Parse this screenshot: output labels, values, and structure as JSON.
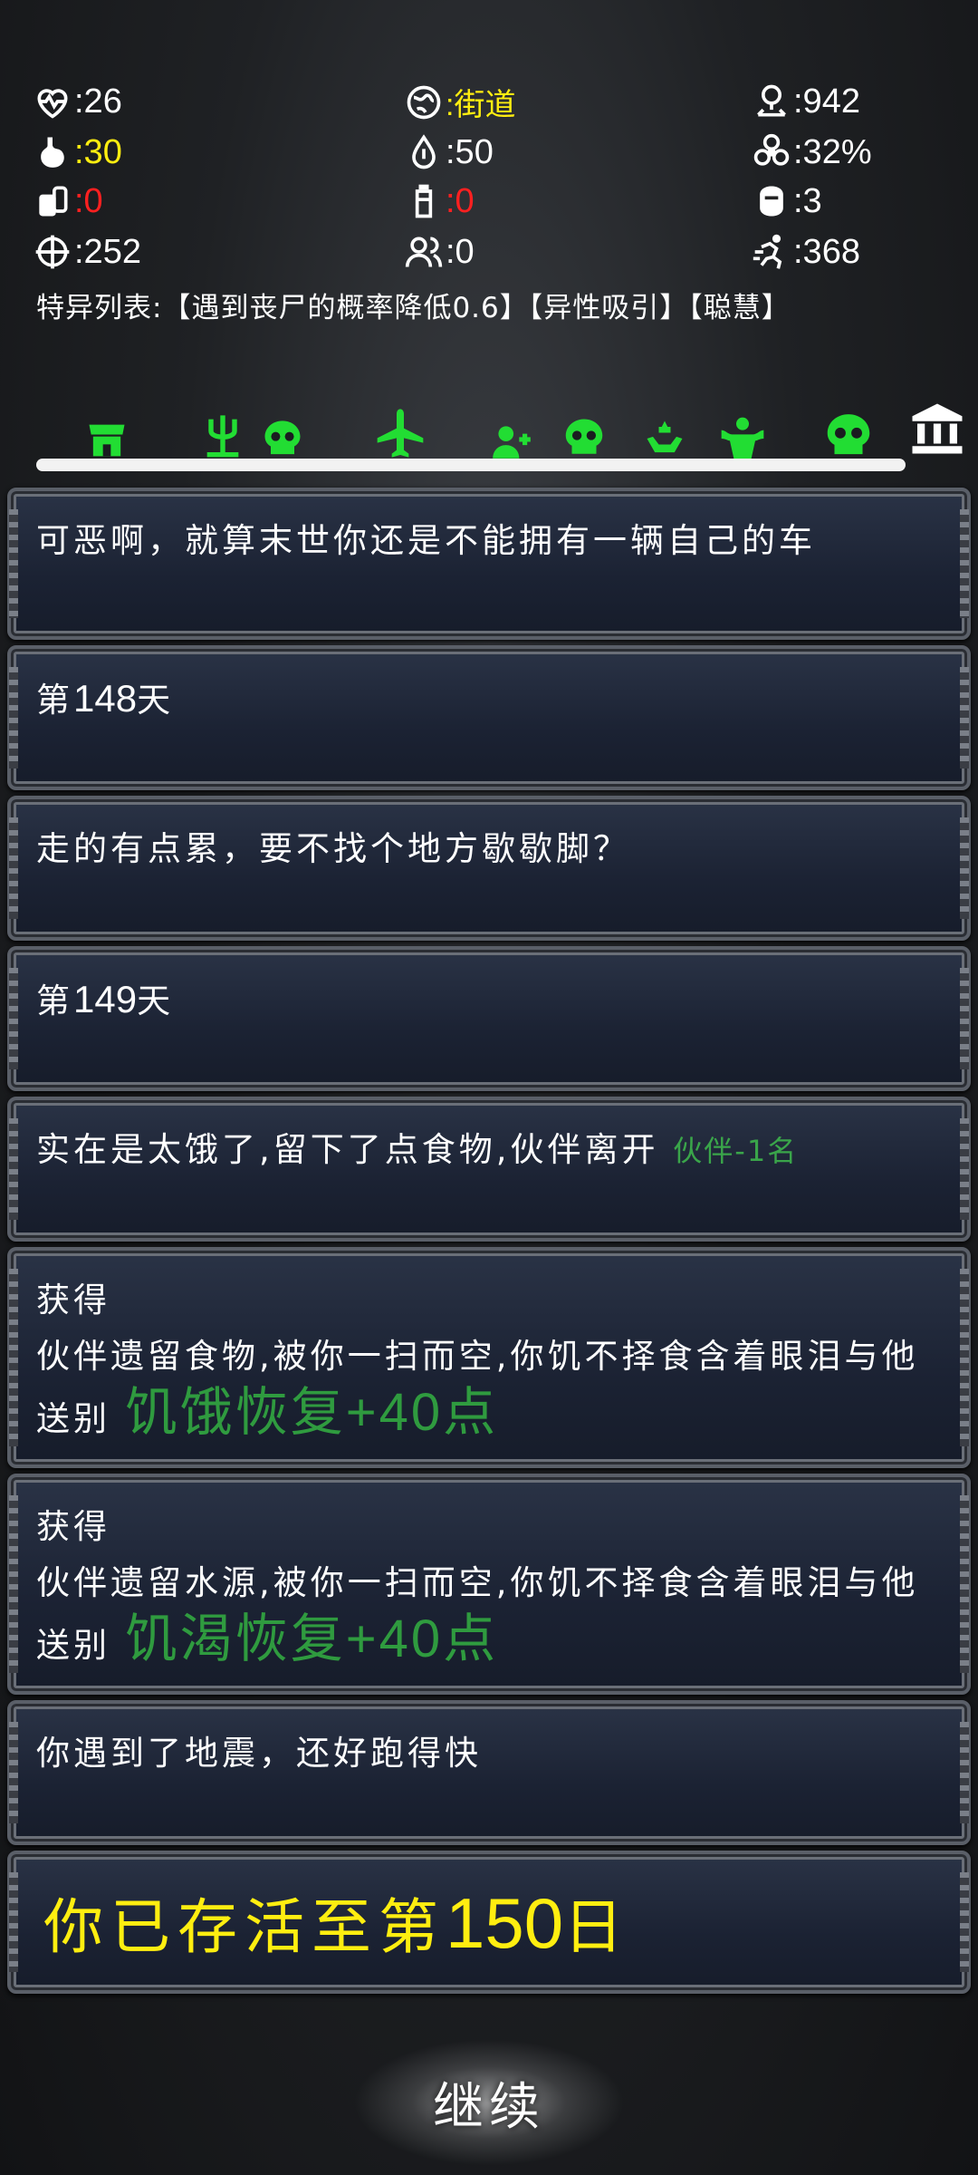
{
  "stats": {
    "health": ":26",
    "location": ":街道",
    "distance": ":942",
    "hunger": ":30",
    "water": ":50",
    "infection": ":32%",
    "food": ":0",
    "bottle": ":0",
    "helmet": ":3",
    "target": ":252",
    "companions": ":0",
    "run": ":368"
  },
  "colors": {
    "hunger": "#ffee10",
    "location": "#ffee10",
    "warning": "#ff2020",
    "progress_green": "#22dd33",
    "event_green": "#2f9b3f"
  },
  "traits_line": "特异列表:【遇到丧尸的概率降低0.6】【异性吸引】【聪慧】",
  "progress_icons": [
    "shop-icon",
    "trident-icon",
    "skull-icon",
    "airplane-icon",
    "add-user-icon",
    "skull-icon",
    "healing-hands-icon",
    "muscle-icon",
    "skull-icon",
    "bank-icon"
  ],
  "log": [
    {
      "text": "可恶啊，就算末世你还是不能拥有一辆自己的车"
    },
    {
      "prefix": "第",
      "num": "148",
      "suffix": "天"
    },
    {
      "text": "走的有点累，要不找个地方歇歇脚？"
    },
    {
      "prefix": "第",
      "num": "149",
      "suffix": "天"
    },
    {
      "text": "实在是太饿了,留下了点食物,伙伴离开",
      "tag": "伙伴-1名"
    },
    {
      "title": "获得",
      "text": "伙伴遗留食物,被你一扫而空,你饥不择食含着眼泪与他送别",
      "bonus": "饥饿恢复+40点"
    },
    {
      "title": "获得",
      "text": "伙伴遗留水源,被你一扫而空,你饥不择食含着眼泪与他送别",
      "bonus": "饥渴恢复+40点"
    },
    {
      "text": "你遇到了地震，还好跑得快"
    },
    {
      "prefix": "你已存活至第",
      "num": "150",
      "suffix": "日"
    }
  ],
  "continue_label": "继续"
}
